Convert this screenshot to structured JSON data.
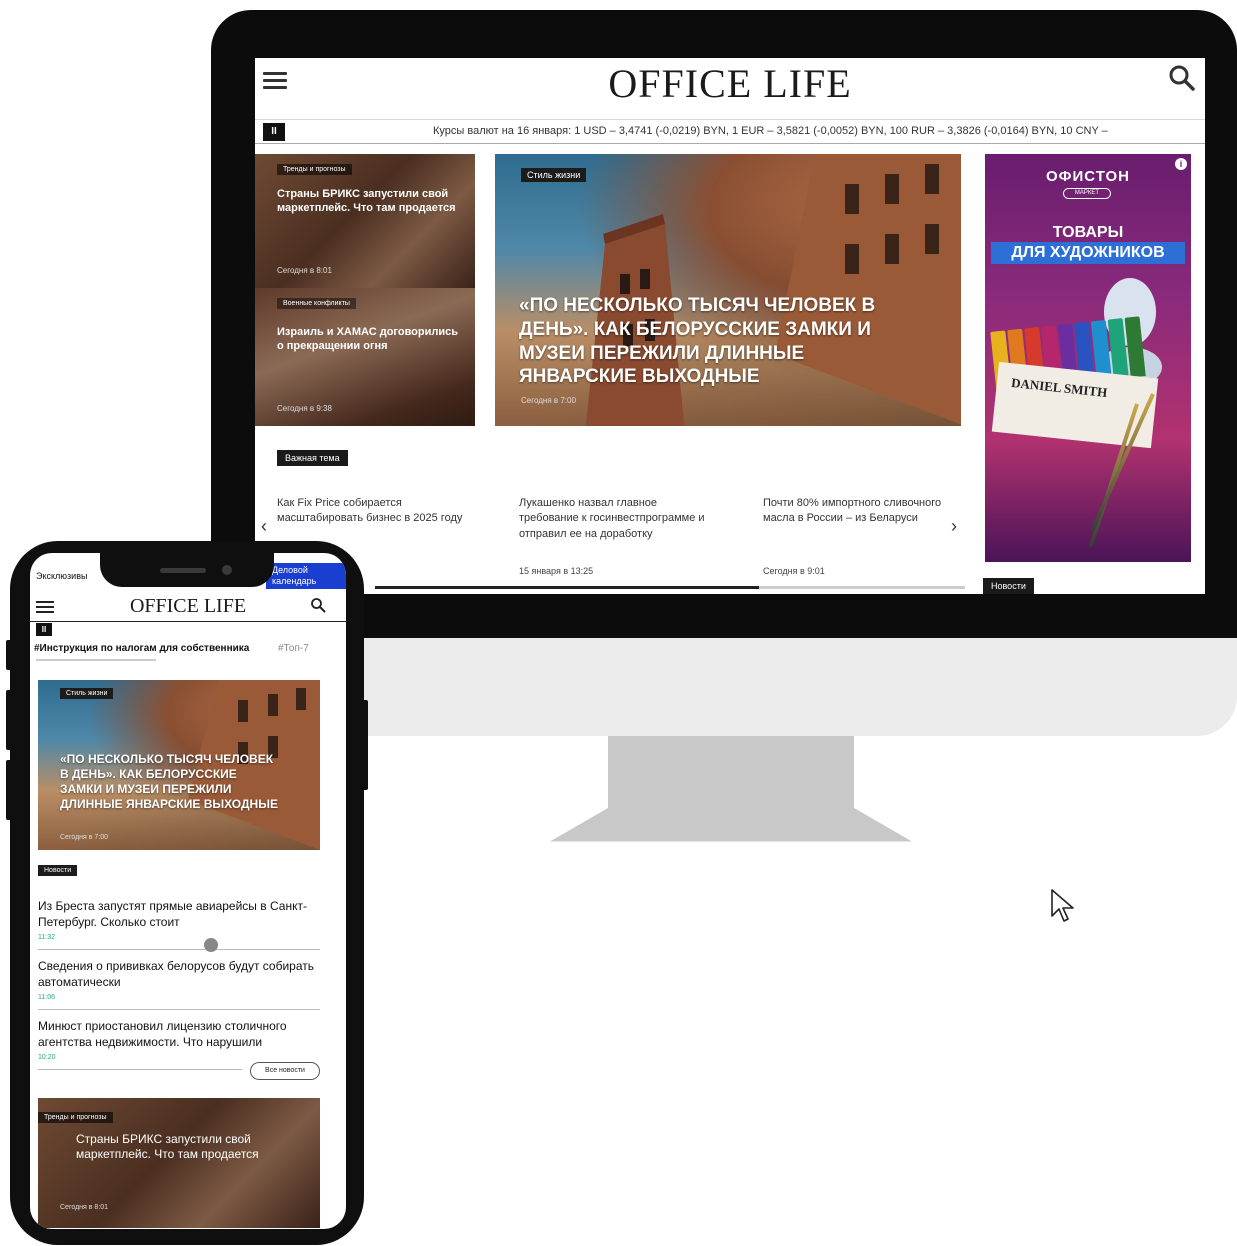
{
  "desktop": {
    "logo": "OFFICE LIFE",
    "ticker": {
      "pause_label": "II",
      "text": "Курсы валют на 16 января: 1 USD – 3,4741 (-0,0219) BYN, 1 EUR – 3,5821 (-0,0052) BYN, 100 RUR – 3,3826 (-0,0164) BYN, 10 CNY –"
    },
    "left_cards": [
      {
        "category": "Тренды и прогнозы",
        "title": "Страны БРИКС запустили свой маркетплейс. Что там продается",
        "date": "Сегодня в 8:01"
      },
      {
        "category": "Военные конфликты",
        "title": "Израиль и ХАМАС договорились о прекращении огня",
        "date": "Сегодня в 9:38"
      }
    ],
    "hero": {
      "category": "Стиль жизни",
      "title": "«ПО НЕСКОЛЬКО ТЫСЯЧ ЧЕЛОВЕК В ДЕНЬ». КАК БЕЛОРУССКИЕ ЗАМКИ И МУЗЕИ ПЕРЕЖИЛИ ДЛИННЫЕ ЯНВАРСКИЕ ВЫХОДНЫЕ",
      "date": "Сегодня в 7:00"
    },
    "ad": {
      "logo": "ОФИСТОН",
      "logo_sub": "МАРКЕТ",
      "line1": "ТОВАРЫ",
      "line2": "ДЛЯ ХУДОЖНИКОВ",
      "brand": "DANIEL SMITH",
      "info": "i"
    },
    "important_badge": "Важная тема",
    "news": [
      {
        "title": "Как Fix Price собирается масштабировать бизнес в 2025 году",
        "date": ""
      },
      {
        "title": "Лукашенко назвал главное требование к госинвестпрограмме и отправил ее на доработку",
        "date": "15 января в 13:25"
      },
      {
        "title": "Почти 80% импортного сливочного масла в России – из Беларуси",
        "date": "Сегодня в 9:01"
      }
    ],
    "arrow_left": "‹",
    "arrow_right": "›",
    "carousel_progress": 0.65,
    "news_badge": "Новости"
  },
  "mobile": {
    "exclusive_label": "Эксклюзивы",
    "calendar_label": "Деловой календарь",
    "logo": "OFFICE LIFE",
    "pause_label": "II",
    "tag_primary": "#Инструкция по налогам для собственника",
    "tag_secondary": "#Топ-7",
    "hero": {
      "category": "Стиль жизни",
      "title": "«ПО НЕСКОЛЬКО ТЫСЯЧ ЧЕЛОВЕК В ДЕНЬ». КАК БЕЛОРУССКИЕ ЗАМКИ И МУЗЕИ ПЕРЕЖИЛИ ДЛИННЫЕ ЯНВАРСКИЕ ВЫХОДНЫЕ",
      "date": "Сегодня в 7:00"
    },
    "news_badge": "Новости",
    "news": [
      {
        "title": "Из Бреста запустят прямые авиарейсы в Санкт-Петербург. Сколько стоит",
        "time": "11:32"
      },
      {
        "title": "Сведения о прививках белорусов будут собирать автоматически",
        "time": "11:06"
      },
      {
        "title": "Минюст приостановил лицензию столичного агентства недвижимости. Что нарушили",
        "time": "10:20"
      }
    ],
    "all_news_button": "Все новости",
    "bottom_card": {
      "category": "Тренды и прогнозы",
      "title": "Страны БРИКС запустили свой маркетплейс. Что там продается",
      "date": "Сегодня в 8:01"
    }
  },
  "colors": {
    "monitor_bezel": "#0c0c0c",
    "monitor_chin": "#ebebeb",
    "stand": "#c8c8c8",
    "calendar_blue": "#1a3fd0",
    "time_green": "#22a889",
    "ad_purple": "#8a2a7c",
    "ad_blue": "#2c6fd6"
  }
}
